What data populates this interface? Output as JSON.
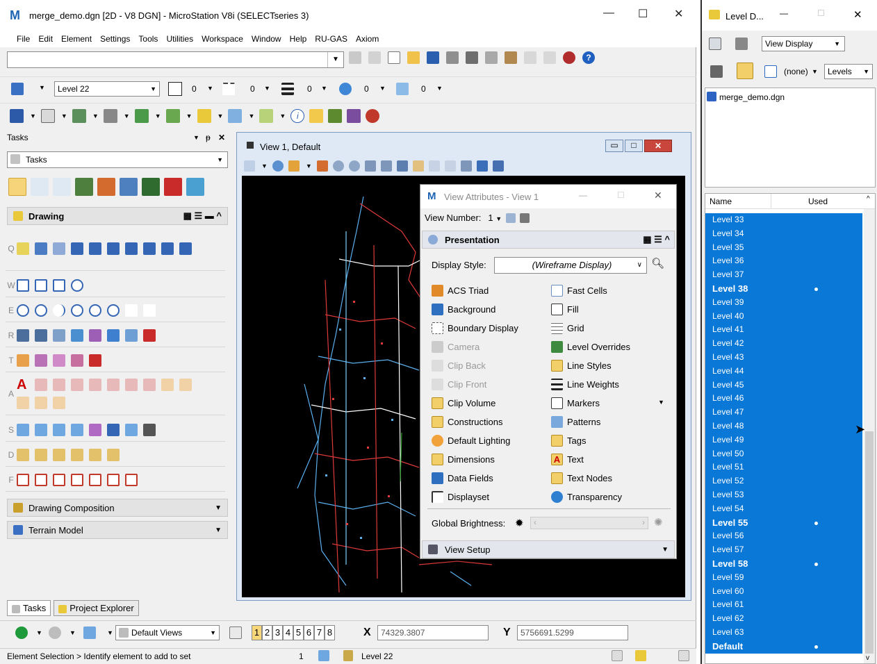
{
  "title": {
    "text": "merge_demo.dgn [2D - V8 DGN] - MicroStation V8i (SELECTseries 3)"
  },
  "menu": [
    "File",
    "Edit",
    "Element",
    "Settings",
    "Tools",
    "Utilities",
    "Workspace",
    "Window",
    "Help",
    "RU-GAS",
    "Axiom"
  ],
  "attributes": {
    "level": "Level 22",
    "color": "0",
    "style": "0",
    "weight": "0",
    "transparency": "0",
    "priority": "0"
  },
  "tasks": {
    "header": "Tasks",
    "combo": "Tasks",
    "drawing_title": "Drawing",
    "row_keys": [
      "Q",
      "W",
      "E",
      "R",
      "T",
      "A",
      "S",
      "D",
      "F"
    ],
    "groups": [
      "Drawing Composition",
      "Terrain Model"
    ],
    "bottom_tabs": [
      "Tasks",
      "Project Explorer"
    ]
  },
  "view": {
    "title": "View 1, Default"
  },
  "view_attributes": {
    "title": "View Attributes - View 1",
    "view_number_label": "View Number:",
    "view_number": "1",
    "section": "Presentation",
    "display_style_label": "Display Style:",
    "display_style": "(Wireframe Display)",
    "left_items": [
      {
        "label": "ACS Triad",
        "enabled": true,
        "icon": "acs-triad-icon"
      },
      {
        "label": "Background",
        "enabled": true,
        "icon": "background-icon"
      },
      {
        "label": "Boundary Display",
        "enabled": true,
        "icon": "boundary-display-icon"
      },
      {
        "label": "Camera",
        "enabled": false,
        "icon": "camera-icon"
      },
      {
        "label": "Clip Back",
        "enabled": false,
        "icon": "clip-back-icon"
      },
      {
        "label": "Clip Front",
        "enabled": false,
        "icon": "clip-front-icon"
      },
      {
        "label": "Clip Volume",
        "enabled": true,
        "icon": "clip-volume-icon"
      },
      {
        "label": "Constructions",
        "enabled": true,
        "icon": "constructions-icon"
      },
      {
        "label": "Default Lighting",
        "enabled": true,
        "icon": "default-lighting-icon"
      },
      {
        "label": "Dimensions",
        "enabled": true,
        "icon": "dimensions-icon"
      },
      {
        "label": "Data Fields",
        "enabled": true,
        "icon": "data-fields-icon"
      },
      {
        "label": "Displayset",
        "enabled": true,
        "icon": "displayset-icon"
      }
    ],
    "right_items": [
      {
        "label": "Fast Cells",
        "icon": "fast-cells-icon"
      },
      {
        "label": "Fill",
        "icon": "fill-icon"
      },
      {
        "label": "Grid",
        "icon": "grid-icon"
      },
      {
        "label": "Level Overrides",
        "icon": "level-overrides-icon"
      },
      {
        "label": "Line Styles",
        "icon": "line-styles-icon"
      },
      {
        "label": "Line Weights",
        "icon": "line-weights-icon"
      },
      {
        "label": "Markers",
        "icon": "markers-icon"
      },
      {
        "label": "Patterns",
        "icon": "patterns-icon"
      },
      {
        "label": "Tags",
        "icon": "tags-icon"
      },
      {
        "label": "Text",
        "icon": "text-icon"
      },
      {
        "label": "Text Nodes",
        "icon": "text-nodes-icon"
      },
      {
        "label": "Transparency",
        "icon": "transparency-icon"
      }
    ],
    "global_brightness_label": "Global Brightness:",
    "view_setup": "View Setup"
  },
  "nav_bar": {
    "views_combo": "Default Views",
    "view_numbers": [
      "1",
      "2",
      "3",
      "4",
      "5",
      "6",
      "7",
      "8"
    ],
    "x_label": "X",
    "x_value": "74329.3807",
    "y_label": "Y",
    "y_value": "5756691.5299"
  },
  "status": {
    "prompt": "Element Selection > Identify element to add to set",
    "count": "1",
    "level": "Level 22"
  },
  "level_display": {
    "title": "Level D...",
    "combo": "View Display",
    "filter": "(none)",
    "levels_btn": "Levels",
    "file": "merge_demo.dgn",
    "col_name": "Name",
    "col_used": "Used",
    "rows": [
      {
        "name": "Level 33",
        "used": false
      },
      {
        "name": "Level 34",
        "used": false
      },
      {
        "name": "Level 35",
        "used": false
      },
      {
        "name": "Level 36",
        "used": false
      },
      {
        "name": "Level 37",
        "used": false
      },
      {
        "name": "Level 38",
        "used": true
      },
      {
        "name": "Level 39",
        "used": false
      },
      {
        "name": "Level 40",
        "used": false
      },
      {
        "name": "Level 41",
        "used": false
      },
      {
        "name": "Level 42",
        "used": false
      },
      {
        "name": "Level 43",
        "used": false
      },
      {
        "name": "Level 44",
        "used": false
      },
      {
        "name": "Level 45",
        "used": false
      },
      {
        "name": "Level 46",
        "used": false
      },
      {
        "name": "Level 47",
        "used": false
      },
      {
        "name": "Level 48",
        "used": false
      },
      {
        "name": "Level 49",
        "used": false
      },
      {
        "name": "Level 50",
        "used": false
      },
      {
        "name": "Level 51",
        "used": false
      },
      {
        "name": "Level 52",
        "used": false
      },
      {
        "name": "Level 53",
        "used": false
      },
      {
        "name": "Level 54",
        "used": false
      },
      {
        "name": "Level 55",
        "used": true
      },
      {
        "name": "Level 56",
        "used": false
      },
      {
        "name": "Level 57",
        "used": false
      },
      {
        "name": "Level 58",
        "used": true
      },
      {
        "name": "Level 59",
        "used": false
      },
      {
        "name": "Level 60",
        "used": false
      },
      {
        "name": "Level 61",
        "used": false
      },
      {
        "name": "Level 62",
        "used": false
      },
      {
        "name": "Level 63",
        "used": false
      },
      {
        "name": "Default",
        "used": true
      }
    ]
  },
  "colors": {
    "selection": "#0a78d7",
    "accent": "#1d64b4",
    "canvas": "#000000"
  }
}
